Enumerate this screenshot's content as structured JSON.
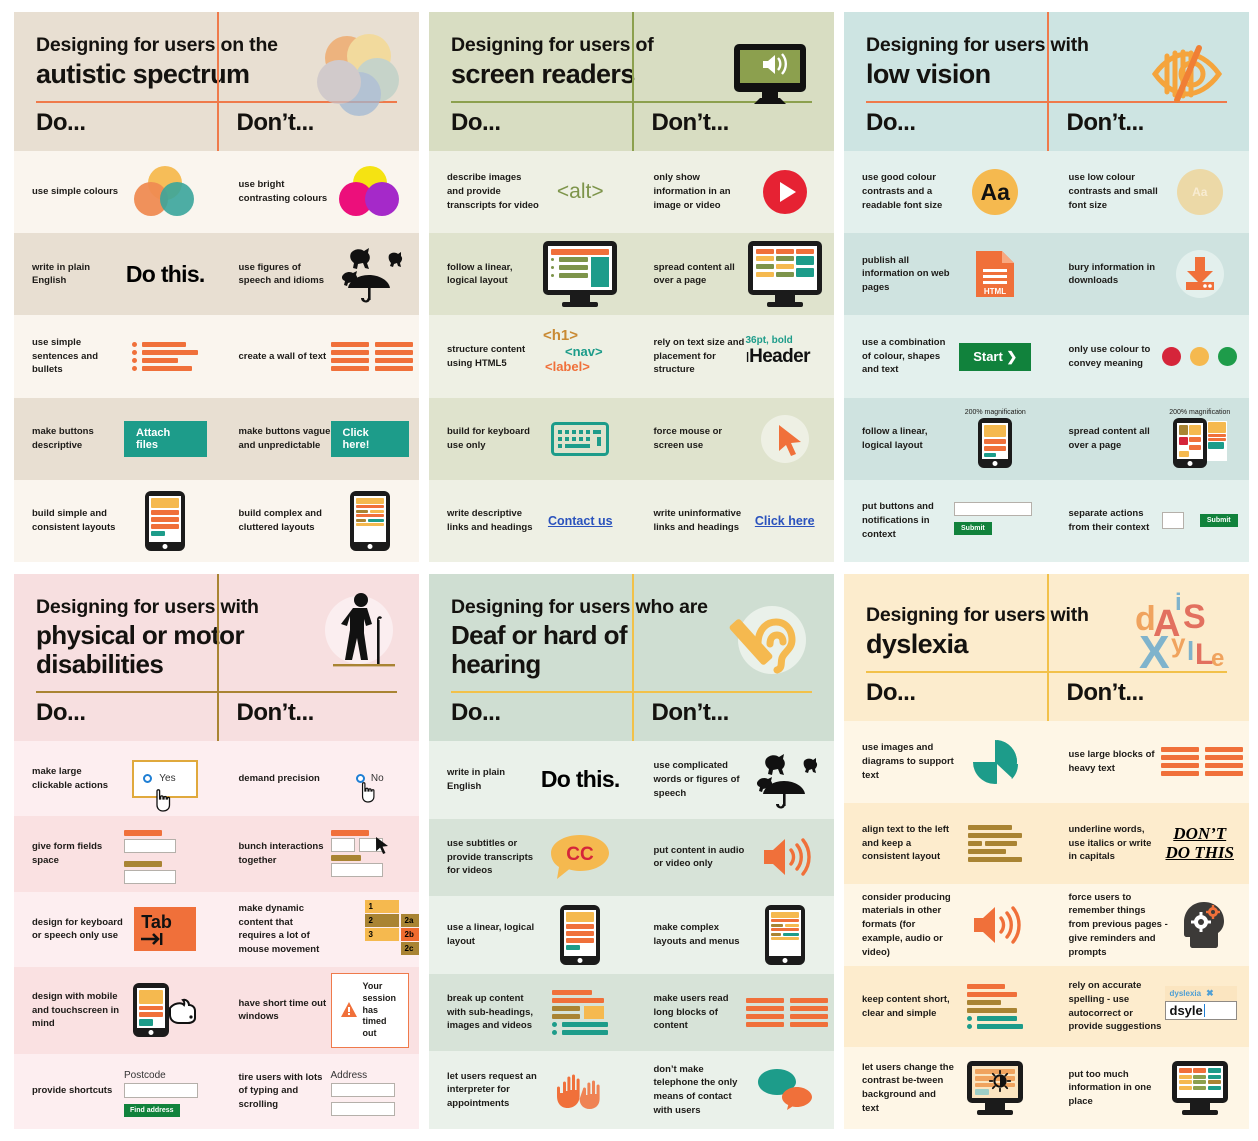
{
  "common": {
    "do_label": "Do...",
    "dont_label": "Don’t..."
  },
  "posters": [
    {
      "id": "autistic-spectrum",
      "line1": "Designing for users on the",
      "line2": "autistic spectrum",
      "bg": "#e8dfd2",
      "rule": "#ef7a4b",
      "row_alt": "#f6efe6",
      "row_base": "#faf5ee",
      "icon": "venn-circles-icon",
      "rows": [
        {
          "do": "use simple colours",
          "dont": "use bright contrasting colours",
          "do_art": "soft-venn",
          "dont_art": "bright-venn"
        },
        {
          "do": "write in plain English",
          "dont": "use figures of speech and idioms",
          "do_art": "do-this-text",
          "do_text": "Do this.",
          "dont_art": "cats-and-dogs"
        },
        {
          "do": "use simple sentences and bullets",
          "dont": "create a wall of text",
          "do_art": "bullet-list",
          "dont_art": "wall-of-text"
        },
        {
          "do": "make buttons descriptive",
          "dont": "make buttons vague and unpredictable",
          "do_art": "button",
          "do_text": "Attach files",
          "dont_art": "button",
          "dont_text": "Click here!"
        },
        {
          "do": "build simple and consistent layouts",
          "dont": "build complex and cluttered layouts",
          "do_art": "tablet-simple",
          "dont_art": "tablet-cluttered"
        }
      ]
    },
    {
      "id": "screen-readers",
      "line1": "Designing for users of",
      "line2": "screen readers",
      "bg": "#d8ddc2",
      "rule": "#8ca04e",
      "row_alt": "#dfe3cd",
      "row_base": "#eef0e4",
      "icon": "monitor-speaker-icon",
      "rows": [
        {
          "do": "describe images and provide transcripts for video",
          "dont": "only show information in an image or video",
          "do_art": "alt-tag",
          "do_text": "<alt>",
          "dont_art": "play-button"
        },
        {
          "do": "follow a linear, logical layout",
          "dont": "spread content all over a page",
          "do_art": "monitor-linear",
          "dont_art": "monitor-spread"
        },
        {
          "do": "structure content using HTML5",
          "dont": "rely on text size and placement for structure",
          "do_art": "html-tags",
          "dont_art": "header-text",
          "dont_text_small": "36pt, bold",
          "dont_text": "Header"
        },
        {
          "do": "build for keyboard use only",
          "dont": "force mouse or screen use",
          "do_art": "keyboard",
          "dont_art": "cursor"
        },
        {
          "do": "write descriptive links and headings",
          "dont": "write uninformative links and headings",
          "do_art": "link",
          "do_text": "Contact us",
          "dont_art": "link",
          "dont_text": "Click here"
        }
      ]
    },
    {
      "id": "low-vision",
      "line1": "Designing for users with",
      "line2": "low vision",
      "bg": "#cde4e2",
      "rule": "#ef7a4b",
      "row_alt": "#cfe3e0",
      "row_base": "#e3f0ed",
      "icon": "crossed-eye-icon",
      "rows": [
        {
          "do": "use good colour contrasts and a readable font size",
          "dont": "use low colour contrasts and small font size",
          "do_art": "aa-high",
          "do_text": "Aa",
          "dont_art": "aa-low",
          "dont_text": "Aa"
        },
        {
          "do": "publish all information on web pages",
          "dont": "bury information in downloads",
          "do_art": "html-doc",
          "do_text": "HTML",
          "dont_art": "download"
        },
        {
          "do": "use a combination of colour, shapes and text",
          "dont": "only use colour to convey meaning",
          "do_art": "start-button",
          "do_text": "Start ❯",
          "dont_art": "traffic-dots"
        },
        {
          "do": "follow a linear, logical layout",
          "dont": "spread content all over a page",
          "do_art": "tablet-mag",
          "do_caption": "200% magnification",
          "dont_art": "tablet-mag-spread",
          "dont_caption": "200% magnification"
        },
        {
          "do": "put buttons and notifications in context",
          "dont": "separate actions from their context",
          "do_art": "field-with-submit",
          "do_text": "Submit",
          "dont_art": "field-separated",
          "dont_text": "Submit"
        }
      ]
    },
    {
      "id": "physical-motor",
      "line1": "Designing for users with",
      "line2": "physical or motor disabilities",
      "bg": "#f7dfe0",
      "rule": "#a98433",
      "row_alt": "#fae1e2",
      "row_base": "#fdeef0",
      "icon": "person-with-cane-icon",
      "rows": [
        {
          "do": "make large clickable actions",
          "dont": "demand precision",
          "do_art": "radio-large",
          "do_text": "Yes",
          "dont_art": "radio-small",
          "dont_text": "No"
        },
        {
          "do": "give form fields space",
          "dont": "bunch interactions together",
          "do_art": "spaced-fields",
          "dont_art": "bunched-fields"
        },
        {
          "do": "design for keyboard or speech only use",
          "dont": "make dynamic content that requires a lot of mouse movement",
          "do_art": "tab-key",
          "do_text": "Tab",
          "dont_art": "menu-cascade",
          "dont_items": [
            "1",
            "2",
            "3",
            "2a",
            "2b",
            "2c"
          ]
        },
        {
          "do": "design with mobile and touchscreen in mind",
          "dont": "have short time out windows",
          "do_art": "tablet-touch",
          "dont_art": "timeout-alert",
          "dont_text": "Your session has timed out"
        },
        {
          "do": "provide shortcuts",
          "dont": "tire users with lots of typing and scrolling",
          "do_art": "postcode-lookup",
          "do_caption": "Postcode",
          "do_text": "Find address",
          "dont_art": "address-fields",
          "dont_caption": "Address"
        }
      ]
    },
    {
      "id": "deaf-hard-of-hearing",
      "line1": "Designing for users who are",
      "line2": "Deaf or hard of hearing",
      "bg": "#cfded2",
      "rule": "#f2c14a",
      "row_alt": "#d7e3d8",
      "row_base": "#eaf1ea",
      "icon": "ear-hearing-aid-icon",
      "rows": [
        {
          "do": "write in plain English",
          "dont": "use complicated words or figures of speech",
          "do_art": "do-this-text",
          "do_text": "Do this.",
          "dont_art": "cats-and-dogs"
        },
        {
          "do": "use subtitles or provide transcripts for videos",
          "dont": "put content in audio or video only",
          "do_art": "cc-bubble",
          "do_text": "CC",
          "dont_art": "speaker"
        },
        {
          "do": "use a linear, logical layout",
          "dont": "make complex layouts and menus",
          "do_art": "tablet-simple",
          "dont_art": "tablet-cluttered"
        },
        {
          "do": "break up content with sub-headings, images and videos",
          "dont": "make users read long blocks of content",
          "do_art": "mixed-content",
          "dont_art": "wall-of-text"
        },
        {
          "do": "let users request an interpreter for appointments",
          "dont": "don’t make telephone the only means of contact with users",
          "do_art": "signing-hands",
          "dont_art": "speech-bubbles"
        }
      ]
    },
    {
      "id": "dyslexia",
      "line1": "Designing for users with",
      "line2": "dyslexia",
      "bg": "#fceccd",
      "rule": "#f2c14a",
      "row_alt": "#fdeccd",
      "row_base": "#fef6e6",
      "icon": "jumbled-letters-icon",
      "rows": [
        {
          "do": "use images and diagrams to support text",
          "dont": "use large blocks of heavy text",
          "do_art": "pie-chart",
          "dont_art": "wall-of-text"
        },
        {
          "do": "align text to the left and keep a consistent layout",
          "dont": "underline words, use italics or write in capitals",
          "do_art": "left-aligned-text",
          "dont_art": "dont-do-this",
          "dont_text": "DON’T DO THIS"
        },
        {
          "do": "consider producing materials in other formats (for example, audio or video)",
          "dont": "force users to remember things from previous pages - give reminders and prompts",
          "do_art": "speaker",
          "dont_art": "head-cogs"
        },
        {
          "do": "keep content short, clear and simple",
          "dont": "rely on accurate spelling - use autocorrect or provide suggestions",
          "do_art": "mixed-content",
          "dont_art": "spellcheck",
          "dont_text": "dsyle",
          "dont_caption": "dyslexia"
        },
        {
          "do": "let users change the contrast be-tween background and text",
          "dont": "put too much information in one place",
          "do_art": "contrast-monitor",
          "dont_art": "busy-monitor"
        }
      ]
    }
  ]
}
